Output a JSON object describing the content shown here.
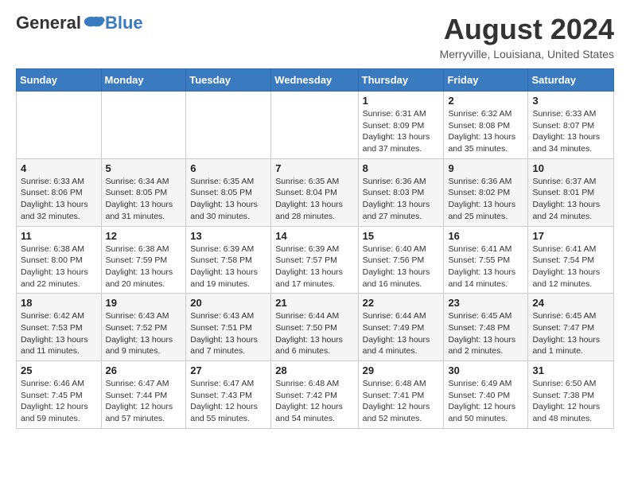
{
  "header": {
    "logo_general": "General",
    "logo_blue": "Blue",
    "month_year": "August 2024",
    "location": "Merryville, Louisiana, United States"
  },
  "days_of_week": [
    "Sunday",
    "Monday",
    "Tuesday",
    "Wednesday",
    "Thursday",
    "Friday",
    "Saturday"
  ],
  "weeks": [
    [
      {
        "day": "",
        "content": ""
      },
      {
        "day": "",
        "content": ""
      },
      {
        "day": "",
        "content": ""
      },
      {
        "day": "",
        "content": ""
      },
      {
        "day": "1",
        "content": "Sunrise: 6:31 AM\nSunset: 8:09 PM\nDaylight: 13 hours\nand 37 minutes."
      },
      {
        "day": "2",
        "content": "Sunrise: 6:32 AM\nSunset: 8:08 PM\nDaylight: 13 hours\nand 35 minutes."
      },
      {
        "day": "3",
        "content": "Sunrise: 6:33 AM\nSunset: 8:07 PM\nDaylight: 13 hours\nand 34 minutes."
      }
    ],
    [
      {
        "day": "4",
        "content": "Sunrise: 6:33 AM\nSunset: 8:06 PM\nDaylight: 13 hours\nand 32 minutes."
      },
      {
        "day": "5",
        "content": "Sunrise: 6:34 AM\nSunset: 8:05 PM\nDaylight: 13 hours\nand 31 minutes."
      },
      {
        "day": "6",
        "content": "Sunrise: 6:35 AM\nSunset: 8:05 PM\nDaylight: 13 hours\nand 30 minutes."
      },
      {
        "day": "7",
        "content": "Sunrise: 6:35 AM\nSunset: 8:04 PM\nDaylight: 13 hours\nand 28 minutes."
      },
      {
        "day": "8",
        "content": "Sunrise: 6:36 AM\nSunset: 8:03 PM\nDaylight: 13 hours\nand 27 minutes."
      },
      {
        "day": "9",
        "content": "Sunrise: 6:36 AM\nSunset: 8:02 PM\nDaylight: 13 hours\nand 25 minutes."
      },
      {
        "day": "10",
        "content": "Sunrise: 6:37 AM\nSunset: 8:01 PM\nDaylight: 13 hours\nand 24 minutes."
      }
    ],
    [
      {
        "day": "11",
        "content": "Sunrise: 6:38 AM\nSunset: 8:00 PM\nDaylight: 13 hours\nand 22 minutes."
      },
      {
        "day": "12",
        "content": "Sunrise: 6:38 AM\nSunset: 7:59 PM\nDaylight: 13 hours\nand 20 minutes."
      },
      {
        "day": "13",
        "content": "Sunrise: 6:39 AM\nSunset: 7:58 PM\nDaylight: 13 hours\nand 19 minutes."
      },
      {
        "day": "14",
        "content": "Sunrise: 6:39 AM\nSunset: 7:57 PM\nDaylight: 13 hours\nand 17 minutes."
      },
      {
        "day": "15",
        "content": "Sunrise: 6:40 AM\nSunset: 7:56 PM\nDaylight: 13 hours\nand 16 minutes."
      },
      {
        "day": "16",
        "content": "Sunrise: 6:41 AM\nSunset: 7:55 PM\nDaylight: 13 hours\nand 14 minutes."
      },
      {
        "day": "17",
        "content": "Sunrise: 6:41 AM\nSunset: 7:54 PM\nDaylight: 13 hours\nand 12 minutes."
      }
    ],
    [
      {
        "day": "18",
        "content": "Sunrise: 6:42 AM\nSunset: 7:53 PM\nDaylight: 13 hours\nand 11 minutes."
      },
      {
        "day": "19",
        "content": "Sunrise: 6:43 AM\nSunset: 7:52 PM\nDaylight: 13 hours\nand 9 minutes."
      },
      {
        "day": "20",
        "content": "Sunrise: 6:43 AM\nSunset: 7:51 PM\nDaylight: 13 hours\nand 7 minutes."
      },
      {
        "day": "21",
        "content": "Sunrise: 6:44 AM\nSunset: 7:50 PM\nDaylight: 13 hours\nand 6 minutes."
      },
      {
        "day": "22",
        "content": "Sunrise: 6:44 AM\nSunset: 7:49 PM\nDaylight: 13 hours\nand 4 minutes."
      },
      {
        "day": "23",
        "content": "Sunrise: 6:45 AM\nSunset: 7:48 PM\nDaylight: 13 hours\nand 2 minutes."
      },
      {
        "day": "24",
        "content": "Sunrise: 6:45 AM\nSunset: 7:47 PM\nDaylight: 13 hours\nand 1 minute."
      }
    ],
    [
      {
        "day": "25",
        "content": "Sunrise: 6:46 AM\nSunset: 7:45 PM\nDaylight: 12 hours\nand 59 minutes."
      },
      {
        "day": "26",
        "content": "Sunrise: 6:47 AM\nSunset: 7:44 PM\nDaylight: 12 hours\nand 57 minutes."
      },
      {
        "day": "27",
        "content": "Sunrise: 6:47 AM\nSunset: 7:43 PM\nDaylight: 12 hours\nand 55 minutes."
      },
      {
        "day": "28",
        "content": "Sunrise: 6:48 AM\nSunset: 7:42 PM\nDaylight: 12 hours\nand 54 minutes."
      },
      {
        "day": "29",
        "content": "Sunrise: 6:48 AM\nSunset: 7:41 PM\nDaylight: 12 hours\nand 52 minutes."
      },
      {
        "day": "30",
        "content": "Sunrise: 6:49 AM\nSunset: 7:40 PM\nDaylight: 12 hours\nand 50 minutes."
      },
      {
        "day": "31",
        "content": "Sunrise: 6:50 AM\nSunset: 7:38 PM\nDaylight: 12 hours\nand 48 minutes."
      }
    ]
  ]
}
